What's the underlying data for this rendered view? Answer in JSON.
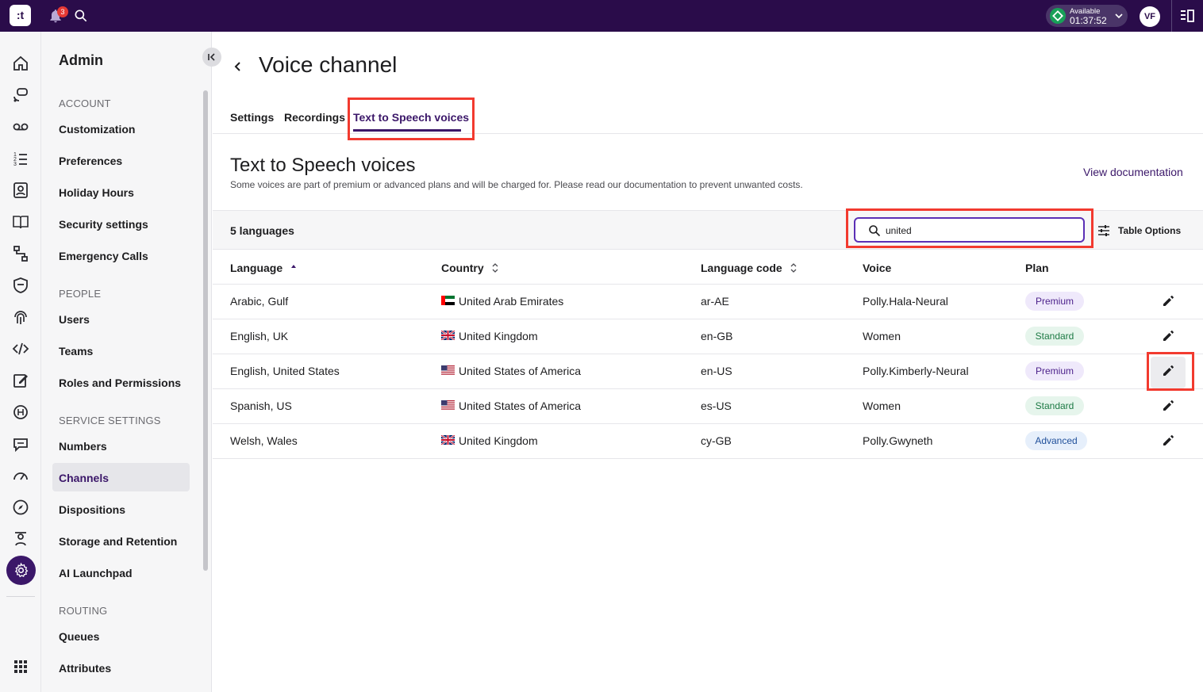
{
  "topbar": {
    "logo": ":t",
    "notifications_count": "3",
    "status_label": "Available",
    "status_time": "01:37:52",
    "avatar_initials": "VF"
  },
  "nav": {
    "title": "Admin",
    "sections": {
      "account": "ACCOUNT",
      "people": "PEOPLE",
      "service": "SERVICE SETTINGS",
      "routing": "ROUTING"
    },
    "items": {
      "customization": "Customization",
      "preferences": "Preferences",
      "holiday_hours": "Holiday Hours",
      "security_settings": "Security settings",
      "emergency_calls": "Emergency Calls",
      "users": "Users",
      "teams": "Teams",
      "roles": "Roles and Permissions",
      "numbers": "Numbers",
      "channels": "Channels",
      "dispositions": "Dispositions",
      "storage": "Storage and Retention",
      "ai_launchpad": "AI Launchpad",
      "queues": "Queues",
      "attributes": "Attributes"
    }
  },
  "page": {
    "title": "Voice channel",
    "tabs": [
      "Settings",
      "Recordings",
      "Text to Speech voices"
    ],
    "section_title": "Text to Speech voices",
    "section_subtitle": "Some voices are part of premium or advanced plans and will be charged for. Please read our documentation to prevent unwanted costs.",
    "doc_link": "View documentation"
  },
  "toolbar": {
    "count_label": "5 languages",
    "search_value": "united",
    "table_options": "Table Options"
  },
  "table": {
    "headers": {
      "language": "Language",
      "country": "Country",
      "code": "Language code",
      "voice": "Voice",
      "plan": "Plan"
    },
    "rows": [
      {
        "language": "Arabic, Gulf",
        "country": "United Arab Emirates",
        "flag": "ae",
        "code": "ar-AE",
        "voice": "Polly.Hala-Neural",
        "plan": "Premium"
      },
      {
        "language": "English, UK",
        "country": "United Kingdom",
        "flag": "gb",
        "code": "en-GB",
        "voice": "Women",
        "plan": "Standard"
      },
      {
        "language": "English, United States",
        "country": "United States of America",
        "flag": "us",
        "code": "en-US",
        "voice": "Polly.Kimberly-Neural",
        "plan": "Premium"
      },
      {
        "language": "Spanish, US",
        "country": "United States of America",
        "flag": "us",
        "code": "es-US",
        "voice": "Women",
        "plan": "Standard"
      },
      {
        "language": "Welsh, Wales",
        "country": "United Kingdom",
        "flag": "gb",
        "code": "cy-GB",
        "voice": "Polly.Gwyneth",
        "plan": "Advanced"
      }
    ]
  },
  "colors": {
    "brand": "#2a0c4a",
    "accent": "#3b1769",
    "highlight": "#f23a2f",
    "premium_bg": "#efe9fb",
    "standard_bg": "#e6f5ec",
    "advanced_bg": "#e6effb"
  }
}
